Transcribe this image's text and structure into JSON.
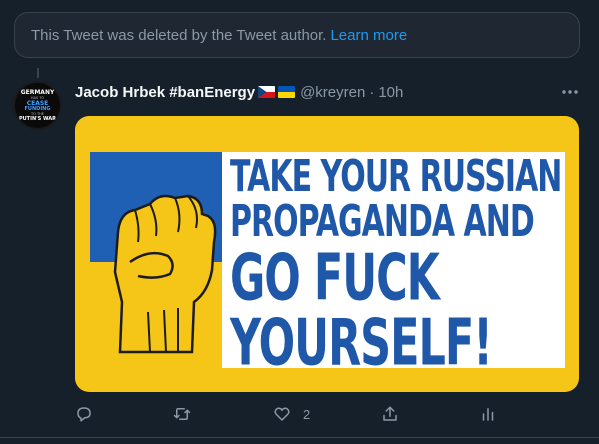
{
  "notice": {
    "text": "This Tweet was deleted by the Tweet author.",
    "link": "Learn more"
  },
  "tweet": {
    "author": {
      "name": "Jacob Hrbek #banEnergy",
      "handle": "@kreyren",
      "flags": [
        "czech-flag-icon",
        "ukraine-flag-icon"
      ],
      "avatar_text": [
        "GERMANY",
        "HAS TO",
        "CEASE",
        "FUNDING",
        "TO THE",
        "PUTIN'S WAR"
      ]
    },
    "separator": "·",
    "time": "10h",
    "image": {
      "lines": [
        "Take your Russian",
        "propaganda and",
        "go fuck",
        "yourself!"
      ]
    },
    "actions": {
      "reply_icon": "reply-icon",
      "retweet_icon": "retweet-icon",
      "like_icon": "heart-icon",
      "like_count": "2",
      "share_icon": "share-icon",
      "analytics_icon": "analytics-icon"
    }
  },
  "colors": {
    "background": "#15202b",
    "accent": "#1d9bf0",
    "muted": "#8b98a5",
    "poster_yellow": "#f5c518",
    "poster_blue": "#1f58a8"
  }
}
